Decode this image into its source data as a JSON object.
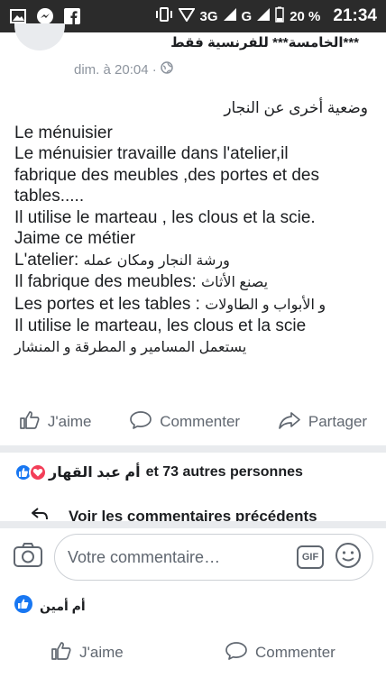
{
  "status_bar": {
    "icons": [
      "image-icon",
      "messenger-icon",
      "facebook-icon"
    ],
    "network": "3G",
    "network2": "G",
    "battery": "20 %",
    "time": "21:34"
  },
  "post": {
    "group_name": "***الخامسة*** للفرنسية فقط",
    "timestamp": "dim. à 20:04 ·",
    "heading": "وضعية أخرى عن النجار",
    "lines": [
      "Le ménuisier",
      "Le ménuisier travaille dans l'atelier,il",
      "fabrique des meubles ,des portes et des",
      "tables.....",
      "Il utilise le marteau , les clous et la scie.",
      "Jaime ce métier"
    ],
    "bilingual_lines": [
      {
        "fr": "L'atelier:",
        "ar": "ورشة النجار ومكان عمله"
      },
      {
        "fr": "Il fabrique des meubles:",
        "ar": "يصنع الأثاث"
      },
      {
        "fr": "Les portes et les tables :",
        "ar": "و الأبواب و الطاولات"
      },
      {
        "fr": "Il utilise le marteau, les clous et la scie",
        "ar": ""
      }
    ],
    "last_line_ar": "يستعمل المسامير و المطرقة و المنشار"
  },
  "actions": {
    "like": "J'aime",
    "comment": "Commenter",
    "share": "Partager"
  },
  "reactions": {
    "name": "أم عبد القهار",
    "others": "et 73 autres personnes"
  },
  "previous_comments": "Voir les commentaires précédents",
  "composer": {
    "placeholder": "Votre commentaire…",
    "gif": "GIF"
  },
  "reply": {
    "name": "أم أمين"
  },
  "bottom_actions": {
    "like": "J'aime",
    "comment": "Commenter"
  },
  "colors": {
    "facebook_blue": "#1877f2",
    "love_red": "#f33e58",
    "gray_text": "#606770"
  }
}
